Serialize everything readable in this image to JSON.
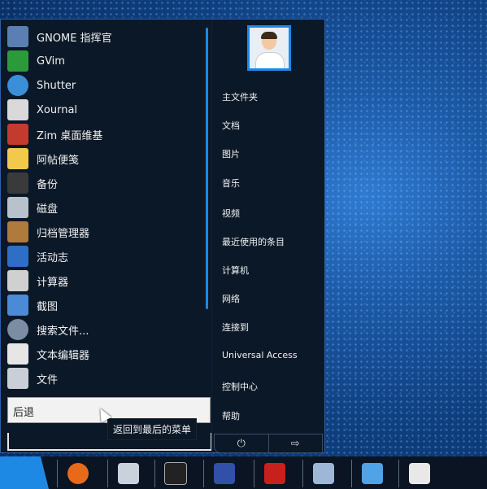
{
  "apps": [
    {
      "label": "GNOME 指挥官",
      "icon": "gnome-commander-icon",
      "color": "#5b7fb3"
    },
    {
      "label": "GVim",
      "icon": "gvim-icon",
      "color": "#2b9b3a"
    },
    {
      "label": "Shutter",
      "icon": "shutter-icon",
      "color": "#3a8fd8"
    },
    {
      "label": "Xournal",
      "icon": "xournal-icon",
      "color": "#d9d9d9"
    },
    {
      "label": "Zim 桌面维基",
      "icon": "zim-icon",
      "color": "#c23b2e"
    },
    {
      "label": "阿帖便笺",
      "icon": "sticky-note-icon",
      "color": "#f2c94c"
    },
    {
      "label": "备份",
      "icon": "backup-icon",
      "color": "#3a3a3a"
    },
    {
      "label": "磁盘",
      "icon": "disk-icon",
      "color": "#b8c2cc"
    },
    {
      "label": "归档管理器",
      "icon": "archive-manager-icon",
      "color": "#b07a3c"
    },
    {
      "label": "活动志",
      "icon": "activity-journal-icon",
      "color": "#2f6ec7"
    },
    {
      "label": "计算器",
      "icon": "calculator-icon",
      "color": "#d0d0d0"
    },
    {
      "label": "截图",
      "icon": "screenshot-icon",
      "color": "#4a8ad6"
    },
    {
      "label": "搜索文件...",
      "icon": "search-files-icon",
      "color": "#7b8da3"
    },
    {
      "label": "文本编辑器",
      "icon": "text-editor-icon",
      "color": "#e6e6e6"
    },
    {
      "label": "文件",
      "icon": "files-icon",
      "color": "#c9cfd6"
    }
  ],
  "search": {
    "value": "后退"
  },
  "tooltip": "返回到最后的菜单",
  "places": [
    "主文件夹",
    "文档",
    "图片",
    "音乐",
    "视频",
    "最近使用的条目",
    "计算机",
    "网络",
    "连接到",
    "Universal Access",
    "控制中心",
    "帮助"
  ],
  "power": {
    "shutdown_icon": "⏻",
    "logout_icon": "⇨"
  },
  "taskbar": [
    {
      "name": "firefox-icon",
      "color": "#e66a1a"
    },
    {
      "name": "disk-utility-icon",
      "color": "#c9d2dc"
    },
    {
      "name": "terminal-icon",
      "color": "#222222"
    },
    {
      "name": "bluefish-icon",
      "color": "#3150a8"
    },
    {
      "name": "filezilla-icon",
      "color": "#c8201c"
    },
    {
      "name": "screenshot-icon",
      "color": "#9fb7d6"
    },
    {
      "name": "network-monitor-icon",
      "color": "#4fa3e8"
    },
    {
      "name": "text-editor-icon",
      "color": "#e8e8e8"
    }
  ],
  "colors": {
    "accent": "#1e88e5",
    "menu_bg": "#0b1828"
  }
}
